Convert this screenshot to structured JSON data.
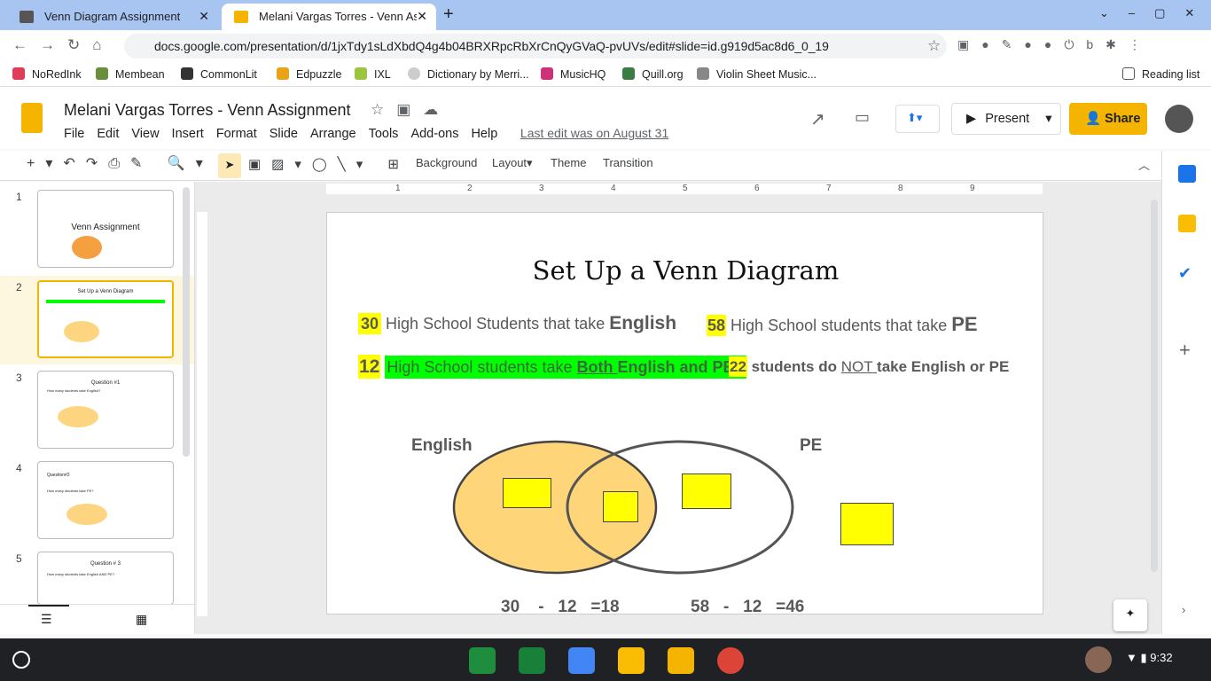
{
  "browser": {
    "tabs": [
      {
        "title": "Venn Diagram Assignment"
      },
      {
        "title": "Melani Vargas Torres - Venn Ass"
      }
    ],
    "url": "docs.google.com/presentation/d/1jxTdy1sLdXbdQ4g4b04BRXRpcRbXrCnQyGVaQ-pvUVs/edit#slide=id.g919d5ac8d6_0_19",
    "bookmarks": [
      "NoRedInk",
      "Membean",
      "CommonLit",
      "Edpuzzle",
      "IXL",
      "Dictionary by Merri...",
      "MusicHQ",
      "Quill.org",
      "Violin Sheet Music..."
    ],
    "reading_list": "Reading list"
  },
  "doc": {
    "title": "Melani Vargas Torres - Venn Assignment",
    "menu": [
      "File",
      "Edit",
      "View",
      "Insert",
      "Format",
      "Slide",
      "Arrange",
      "Tools",
      "Add-ons",
      "Help"
    ],
    "last_edit": "Last edit was on August 31",
    "present": "Present",
    "share": "Share"
  },
  "toolbar": {
    "background": "Background",
    "layout": "Layout",
    "theme": "Theme",
    "transition": "Transition"
  },
  "ruler": [
    "1",
    "2",
    "3",
    "4",
    "5",
    "6",
    "7",
    "8",
    "9"
  ],
  "thumbnails": [
    {
      "num": "1",
      "title": "Venn Assignment"
    },
    {
      "num": "2",
      "title": "Set Up a Venn Diagram"
    },
    {
      "num": "3",
      "title": "Question #1",
      "sub": "How many students take English?"
    },
    {
      "num": "4",
      "title": "Question#2",
      "sub": "How many students take PE?"
    },
    {
      "num": "5",
      "title": "Question # 3",
      "sub": "How many students take English AND PE?"
    }
  ],
  "slide": {
    "title": "Set Up a Venn Diagram",
    "line1a_num": "30",
    "line1a_text": "High School Students that take ",
    "line1a_bold": "English",
    "line1b_num": "58",
    "line1b_text": "High School students that take ",
    "line1b_bold": "PE",
    "line2a_num": "12",
    "line2a_text": "High School students take ",
    "line2a_u": "Both ",
    "line2a_bold": "English and PE",
    "line2b_num": "22",
    "line2b_text": "students do ",
    "line2b_u": "NOT ",
    "line2b_rest": "take English or PE",
    "label_english": "English",
    "label_pe": "PE",
    "calc1": "30    -   12   =18",
    "calc2": "58   -   12   =46"
  },
  "taskbar": {
    "time": "9:32"
  }
}
